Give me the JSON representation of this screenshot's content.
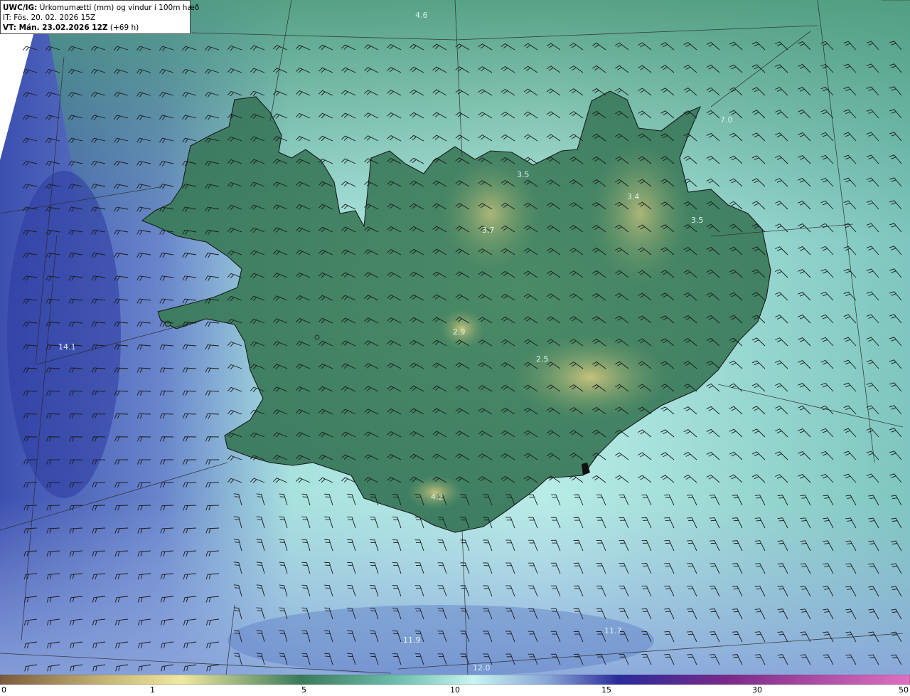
{
  "header": {
    "line1_bold": "UWC/IG:",
    "line1_rest": " Úrkomumætti (mm) og vindur í 100m hæð",
    "line2": "IT: Fös. 20. 02. 2026 15Z",
    "line3_bold": "VT: Mán. 23.02.2026 12Z",
    "line3_rest": " (+69 h)"
  },
  "value_labels": [
    {
      "text": "4.6",
      "kind": "sea"
    },
    {
      "text": "7.0",
      "kind": "sea"
    },
    {
      "text": "3.5",
      "kind": "land"
    },
    {
      "text": "3.4",
      "kind": "land"
    },
    {
      "text": "3.7",
      "kind": "land"
    },
    {
      "text": "3.5",
      "kind": "land"
    },
    {
      "text": "2.9",
      "kind": "land"
    },
    {
      "text": "2.5",
      "kind": "land"
    },
    {
      "text": "4.2",
      "kind": "land"
    },
    {
      "text": "14.1",
      "kind": "sea"
    },
    {
      "text": "11.9",
      "kind": "sea"
    },
    {
      "text": "11.7",
      "kind": "sea"
    },
    {
      "text": "12.0",
      "kind": "sea"
    }
  ],
  "colorbar": {
    "ticks": [
      "0",
      "1",
      "5",
      "10",
      "15",
      "30",
      "50"
    ],
    "colors": [
      "#7b5a3c",
      "#c8b878",
      "#f0e8a0",
      "#3a7a5a",
      "#6fc0b0",
      "#c8f4f0",
      "#8aa8d8",
      "#2a2a9a",
      "#7a2a8a",
      "#e070c0"
    ]
  },
  "colors": {
    "land_low": "#3f7f62",
    "land_high": "#b7c07a",
    "sea_near": "#8fd8ce",
    "sea_far": "#3c4fb0",
    "coast": "#1a1a1a"
  }
}
